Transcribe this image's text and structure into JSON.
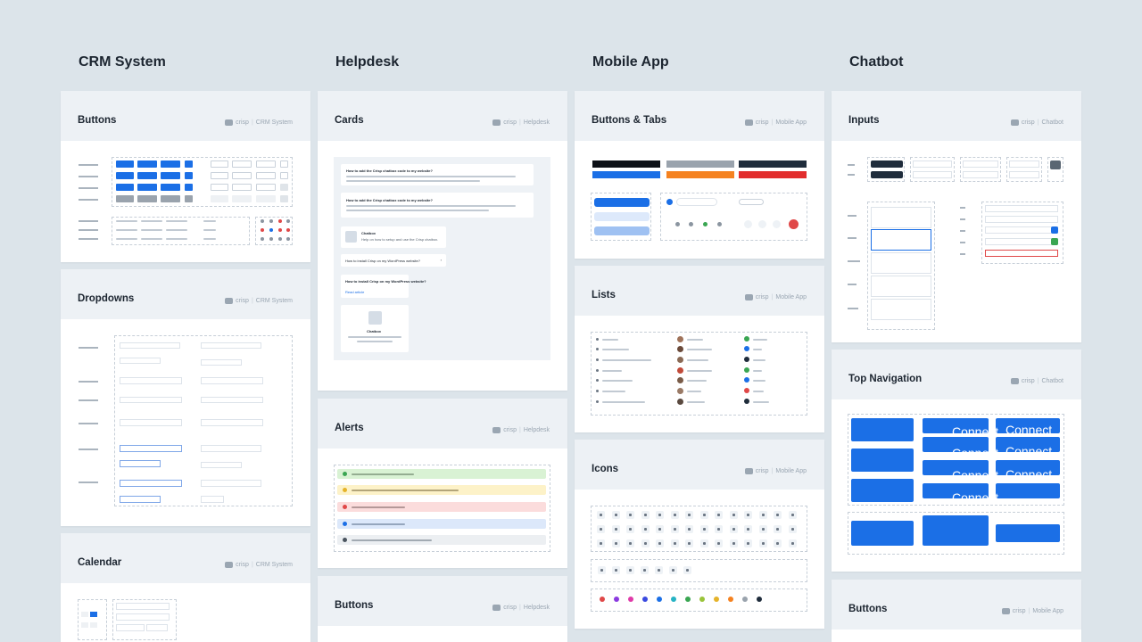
{
  "columns": [
    "CRM System",
    "Helpdesk",
    "Mobile App",
    "Chatbot"
  ],
  "brand": "crisp",
  "cards": {
    "crm_buttons": {
      "title": "Buttons",
      "product": "CRM System"
    },
    "crm_dropdowns": {
      "title": "Dropdowns",
      "product": "CRM System"
    },
    "crm_calendar": {
      "title": "Calendar",
      "product": "CRM System"
    },
    "help_cards": {
      "title": "Cards",
      "product": "Helpdesk"
    },
    "help_alerts": {
      "title": "Alerts",
      "product": "Helpdesk"
    },
    "help_buttons": {
      "title": "Buttons",
      "product": "Helpdesk"
    },
    "mob_buttons_tabs": {
      "title": "Buttons & Tabs",
      "product": "Mobile App"
    },
    "mob_lists": {
      "title": "Lists",
      "product": "Mobile App"
    },
    "mob_icons": {
      "title": "Icons",
      "product": "Mobile App"
    },
    "chat_inputs": {
      "title": "Inputs",
      "product": "Chatbot"
    },
    "chat_topnav": {
      "title": "Top Navigation",
      "product": "Chatbot"
    },
    "chat_buttons": {
      "title": "Buttons",
      "product": "Mobile App"
    }
  },
  "helpdesk_preview": {
    "q1": "How to add the Crisp chatbox code to my website?",
    "q2": "How to add the Crisp chatbox code to my website?",
    "chatbox_title": "Chatbox",
    "chatbox_desc": "Help on how to setup and use the Crisp chatbox.",
    "install_link": "How to install Crisp on my WordPress website?",
    "install_card": "How to install Crisp on my WordPress website?",
    "read_article": "Read article",
    "chatbox_title2": "Chatbox",
    "chatbox_desc2": "Help on how to setup and use the Crisp chatbox."
  },
  "topnav_preview": {
    "connect_labels": [
      "Connect",
      "Connect",
      "Connect",
      "Connect",
      "Connect",
      "Connect",
      "Connect"
    ]
  },
  "colors": {
    "accent": "#1b6fe6",
    "background": "#dce4ea",
    "card_header": "#edf1f5",
    "alert_green": "#d9f2d4",
    "alert_yellow": "#fdf2c8",
    "alert_red": "#fbdcdc",
    "alert_blue": "#dce8fa",
    "alert_gray": "#eceff2"
  }
}
